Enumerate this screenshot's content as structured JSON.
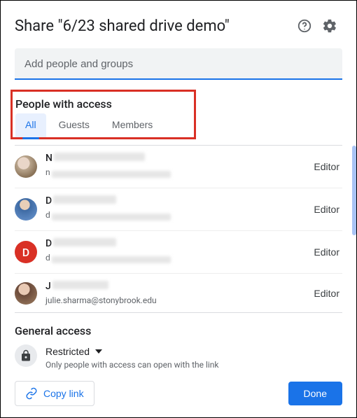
{
  "header": {
    "title": "Share \"6/23 shared drive demo\""
  },
  "input": {
    "placeholder": "Add people and groups"
  },
  "access": {
    "section_title": "People with access",
    "tabs": [
      "All",
      "Guests",
      "Members"
    ],
    "active_tab": 0
  },
  "people": [
    {
      "initial": "N",
      "email_initial": "n",
      "avatar_letter": "",
      "role": "Editor",
      "email_visible": ""
    },
    {
      "initial": "D",
      "email_initial": "d",
      "avatar_letter": "",
      "role": "Editor",
      "email_visible": ""
    },
    {
      "initial": "D",
      "email_initial": "d",
      "avatar_letter": "D",
      "role": "Editor",
      "email_visible": ""
    },
    {
      "initial": "J",
      "email_initial": "",
      "avatar_letter": "",
      "role": "Editor",
      "email_visible": "julie.sharma@stonybrook.edu"
    }
  ],
  "general": {
    "title": "General access",
    "mode": "Restricted",
    "sub": "Only people with access can open with the link"
  },
  "footer": {
    "copy": "Copy link",
    "done": "Done"
  }
}
